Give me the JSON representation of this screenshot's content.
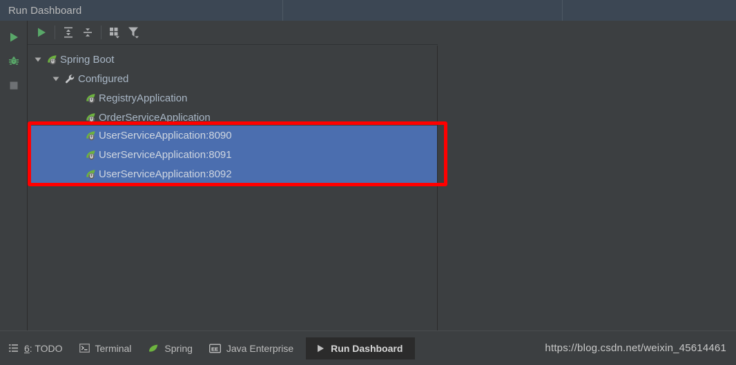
{
  "header": {
    "title": "Run Dashboard",
    "cells": [
      "Run Dashboard",
      "",
      ""
    ]
  },
  "left_rail": {
    "buttons": [
      {
        "name": "run-icon",
        "tooltip": "Run"
      },
      {
        "name": "debug-icon",
        "tooltip": "Debug"
      },
      {
        "name": "stop-icon",
        "tooltip": "Stop"
      }
    ]
  },
  "toolbar": {
    "buttons": [
      {
        "name": "run-icon",
        "tooltip": "Run"
      },
      {
        "name": "expand-all-icon",
        "tooltip": "Expand All"
      },
      {
        "name": "collapse-all-icon",
        "tooltip": "Collapse All"
      },
      {
        "name": "group-by-icon",
        "tooltip": "Group By"
      },
      {
        "name": "filter-icon",
        "tooltip": "Filter"
      }
    ]
  },
  "tree": {
    "nodes": [
      {
        "label": "Spring Boot",
        "level": 0,
        "expanded": true,
        "icon": "spring-boot-icon",
        "selected": false
      },
      {
        "label": "Configured",
        "level": 1,
        "expanded": true,
        "icon": "wrench-icon",
        "selected": false
      },
      {
        "label": "RegistryApplication",
        "level": 2,
        "expanded": null,
        "icon": "spring-boot-icon",
        "selected": false
      },
      {
        "label": "OrderServiceApplication",
        "level": 2,
        "expanded": null,
        "icon": "spring-boot-icon",
        "selected": false
      }
    ],
    "selected_nodes": [
      {
        "label": "UserServiceApplication:8090",
        "level": 2,
        "icon": "spring-boot-icon",
        "selected": true
      },
      {
        "label": "UserServiceApplication:8091",
        "level": 2,
        "icon": "spring-boot-icon",
        "selected": true
      },
      {
        "label": "UserServiceApplication:8092",
        "level": 2,
        "icon": "spring-boot-icon",
        "selected": true
      }
    ]
  },
  "annotation": {
    "color": "#FF0000",
    "shape": "rectangle"
  },
  "colors": {
    "header_bg": "#3C4754",
    "panel_bg": "#3C3F41",
    "selection_blue": "#4B6EAF",
    "text": "#A9B7C6",
    "accent_green": "#5FAD5F",
    "annotation_red": "#FF0000"
  },
  "status_bar": {
    "items": [
      {
        "label": "6: TODO",
        "key": "6",
        "icon": "todo-list-icon",
        "active": false
      },
      {
        "label": "Terminal",
        "icon": "terminal-icon",
        "active": false
      },
      {
        "label": "Spring",
        "icon": "spring-leaf-icon",
        "active": false
      },
      {
        "label": "Java Enterprise",
        "icon": "java-enterprise-icon",
        "active": false
      },
      {
        "label": "Run Dashboard",
        "icon": "run-icon",
        "active": true
      }
    ],
    "watermark": "https://blog.csdn.net/weixin_45614461"
  }
}
